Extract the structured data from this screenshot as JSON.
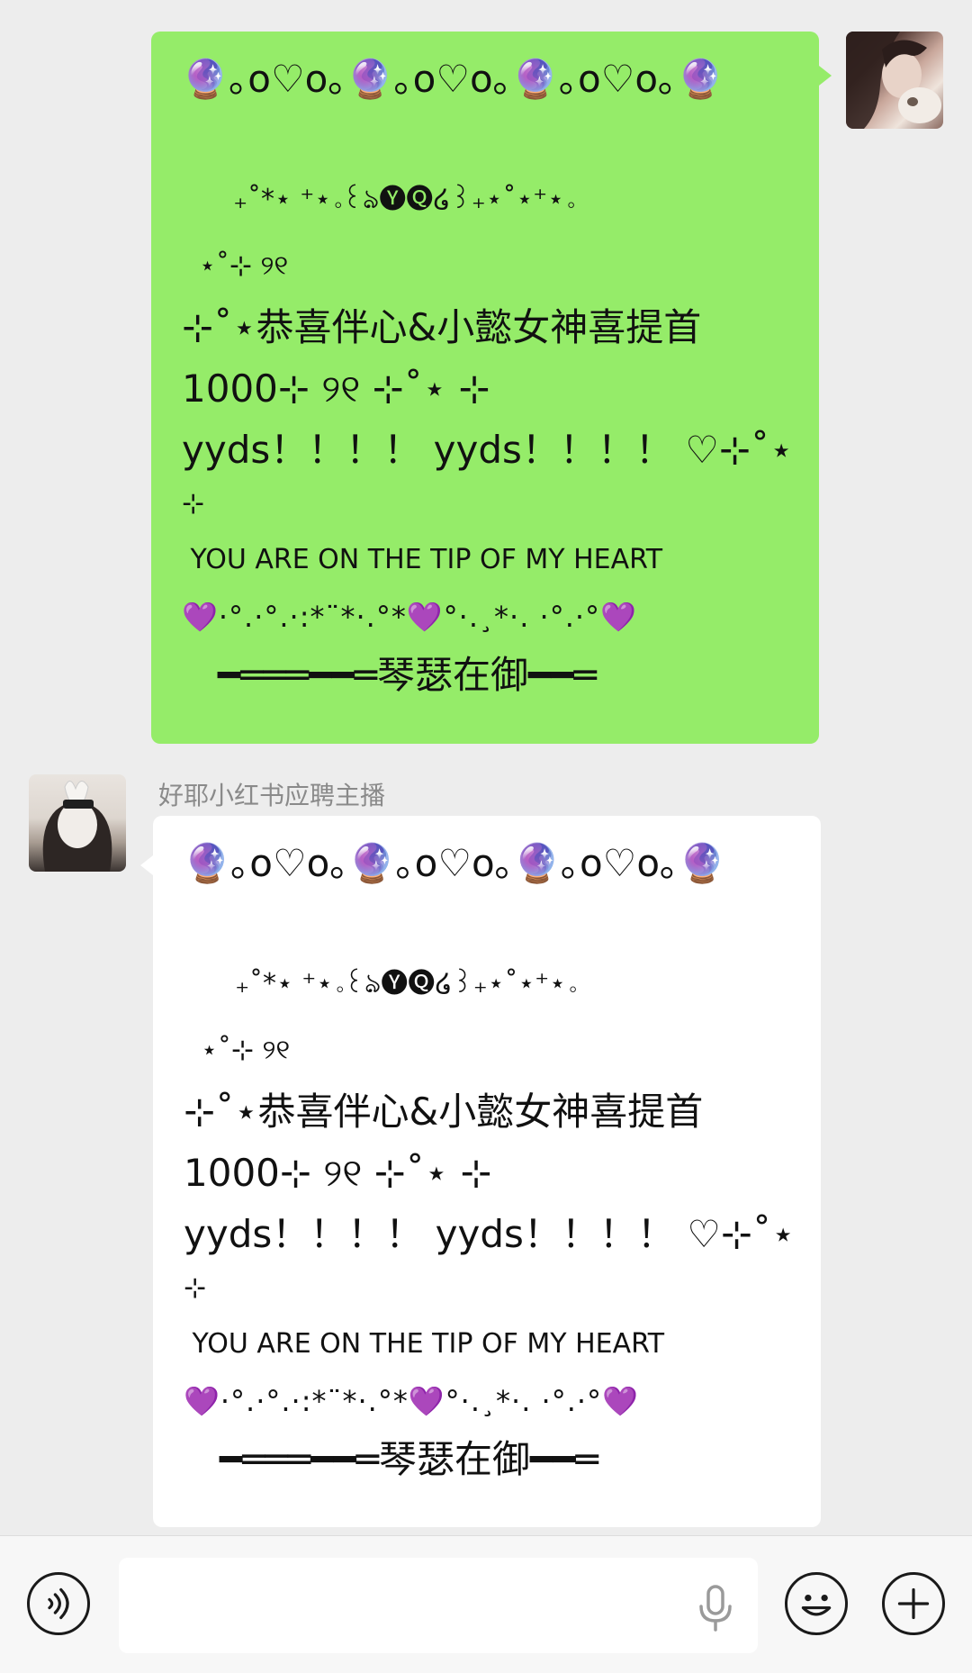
{
  "messages": [
    {
      "type": "sent",
      "lines": [
        "🔮｡o♡o｡🔮｡o♡o｡🔮｡o♡o｡🔮",
        "",
        "      ₊˚*⋆ ⁺⋆｡꒰ঌ🅨🅠໒꒱₊⋆˚⋆⁺⋆｡",
        "  ⋆˚⊹ ୨୧",
        "⊹˚⋆恭喜伴心&小懿女神喜提首",
        "1000⊹ ୨୧ ⊹˚⋆ ⊹",
        "yyds！！！！ yyds！！！！ ♡⊹˚⋆",
        "⊹",
        " YOU ARE ON THE TIP OF MY HEART",
        "💜·°.·°.·:*¨*·.°*💜°·.¸*·. ·°.·°💜",
        "   ━═══━━═琴瑟在御━━═"
      ]
    },
    {
      "type": "received",
      "sender": "好耶小红书应聘主播",
      "lines": [
        "🔮｡o♡o｡🔮｡o♡o｡🔮｡o♡o｡🔮",
        "",
        "      ₊˚*⋆ ⁺⋆｡꒰ঌ🅨🅠໒꒱₊⋆˚⋆⁺⋆｡",
        "  ⋆˚⊹ ୨୧",
        "⊹˚⋆恭喜伴心&小懿女神喜提首",
        "1000⊹ ୨୧ ⊹˚⋆ ⊹",
        "yyds！！！！ yyds！！！！ ♡⊹˚⋆",
        "⊹",
        " YOU ARE ON THE TIP OF MY HEART",
        "💜·°.·°.·:*¨*·.°*💜°·.¸*·. ·°.·°💜",
        "   ━═══━━═琴瑟在御━━═"
      ]
    }
  ],
  "input": {
    "value": "",
    "placeholder": ""
  },
  "icons": {
    "voice": "voice-mode-icon",
    "mic": "microphone-icon",
    "emoji": "emoji-icon",
    "more": "plus-icon"
  },
  "colors": {
    "sent_bubble": "#95ec69",
    "received_bubble": "#ffffff",
    "background": "#ededed"
  }
}
